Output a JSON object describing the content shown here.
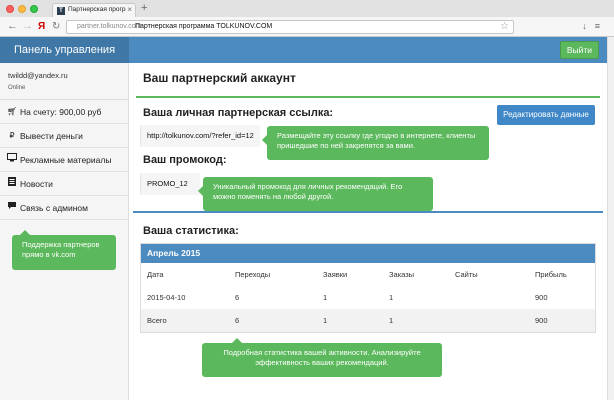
{
  "browser": {
    "tab_title": "Партнерская программа",
    "tab_favicon": "T",
    "address_host": "partner.tolkunov.com",
    "address_title": "Партнерская программа TOLKUNOV.COM"
  },
  "header": {
    "brand": "Панель управления",
    "logout_label": "Выйти"
  },
  "sidebar": {
    "email": "twildd@yandex.ru",
    "status": "Online",
    "items": [
      {
        "icon": "cart-icon",
        "label": "На счету: 900,00  руб"
      },
      {
        "icon": "ruble-icon",
        "label": "Вывести деньги"
      },
      {
        "icon": "monitor-icon",
        "label": "Рекламные материалы"
      },
      {
        "icon": "list-icon",
        "label": "Новости"
      },
      {
        "icon": "chat-icon",
        "label": "Связь с админом"
      }
    ],
    "tip": "Поддержка партнеров прямо в vk.com"
  },
  "main": {
    "title": "Ваш партнерский аккаунт",
    "link_title": "Ваша личная партнерская ссылка:",
    "edit_button": "Редактировать данные",
    "link_value": "http://tolkunov.com/?refer_id=12",
    "link_tip": "Размещайте эту ссылку где угодно в интернете, клиенты пришедшие по ней закрепятся за вами.",
    "promo_title": "Ваш промокод:",
    "promo_value": "PROMO_12",
    "promo_tip": "Уникальный промокод для личных рекомендаций. Его можно поменять на любой другой.",
    "stats_title": "Ваша статистика:",
    "stats_panel_title": "Апрель 2015",
    "stats_tip": "Подробная статистика вашей активности. Анализируйте эффективность ваших рекомендаций."
  },
  "table": {
    "headers": [
      "Дата",
      "Переходы",
      "Заявки",
      "Заказы",
      "Сайты",
      "Прибыль"
    ],
    "rows": [
      [
        "2015-04-10",
        "6",
        "1",
        "1",
        "",
        "900"
      ],
      [
        "Всего",
        "6",
        "1",
        "1",
        "",
        "900"
      ]
    ]
  },
  "colors": {
    "primary": "#4b8bbf",
    "success": "#5cb85c"
  }
}
